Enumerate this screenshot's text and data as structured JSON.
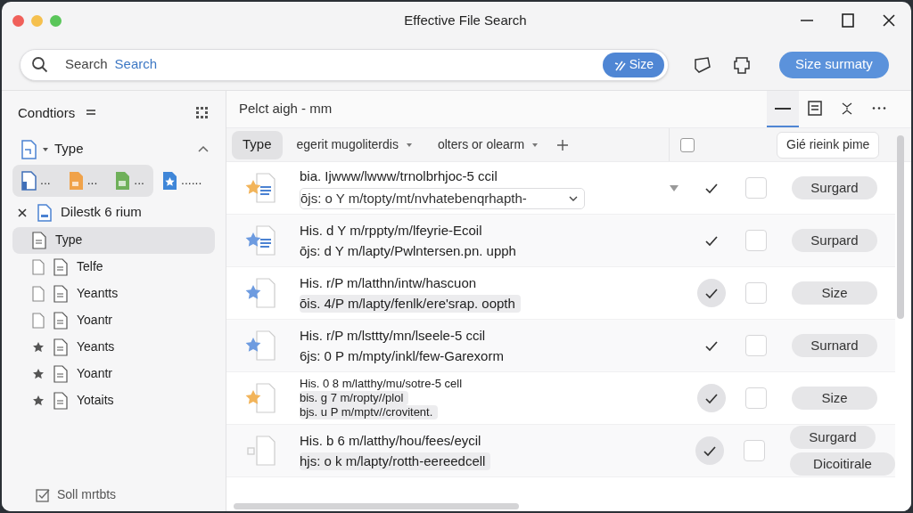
{
  "window": {
    "title": "Effective File Search"
  },
  "search": {
    "label": "Search",
    "value": "Search",
    "chip": "Size"
  },
  "toolbar": {
    "primary_button": "Size surmaty"
  },
  "sidebar": {
    "title": "Condtiors",
    "section": {
      "label": "Type",
      "expanded": true
    },
    "type_chips": [
      {
        "label": "...",
        "kind": "doc",
        "selected": true
      },
      {
        "label": "...",
        "kind": "orange",
        "selected": true
      },
      {
        "label": "...",
        "kind": "green",
        "selected": true
      },
      {
        "label": "......",
        "kind": "star",
        "selected": false
      }
    ],
    "filter": {
      "label": "Dilestk 6 rium"
    },
    "items": [
      {
        "label": "Type",
        "kind": "plain",
        "selected": true
      },
      {
        "label": "Telfe",
        "kind": "file",
        "selected": false
      },
      {
        "label": "Yeantts",
        "kind": "file",
        "selected": false
      },
      {
        "label": "Yoantr",
        "kind": "file",
        "selected": false
      },
      {
        "label": "Yeants",
        "kind": "star",
        "selected": false
      },
      {
        "label": "Yoantr",
        "kind": "star",
        "selected": false
      },
      {
        "label": "Yotaits",
        "kind": "star",
        "selected": false
      }
    ],
    "footer": "Soll mrtbts"
  },
  "main": {
    "heading": "Pelct aigh - mm",
    "views": [
      {
        "kind": "minus",
        "selected": true
      },
      {
        "kind": "list",
        "selected": false
      },
      {
        "kind": "collapse",
        "selected": false
      },
      {
        "kind": "more",
        "selected": false
      }
    ],
    "columns": [
      {
        "label": "Type",
        "selected": true,
        "dropdown": false
      },
      {
        "label": "egerit mugoliterdis",
        "selected": false,
        "dropdown": true
      },
      {
        "label": "olters or olearm",
        "selected": false,
        "dropdown": true
      }
    ],
    "header_checkbox": {
      "checked": false
    },
    "header_button": "Gié rieink pime",
    "rows": [
      {
        "color": "#f2b45a",
        "lines": [
          "bia. Ijwww/lwww/trnolbrhjoc-5 ccil",
          "ōjs: o Y m/topty/mt/nvhatebenqrhapth-"
        ],
        "kind": "dropdown",
        "sort_mark": true,
        "checked": true,
        "highlight": false,
        "selected": false,
        "pills": [
          "Surgard"
        ]
      },
      {
        "color": "#6d9be0",
        "lines": [
          "His. d Y m/rppty/m/lfeyrie-Ecoil",
          "ōjs: d Y m/lapty/Pwlntersen.pn. upph"
        ],
        "kind": "plain",
        "sort_mark": false,
        "checked": true,
        "highlight": false,
        "selected": false,
        "pills": [
          "Surpard"
        ]
      },
      {
        "color": "#6d9be0",
        "lines": [
          "His. r/P m/latthn/intw/hascuon",
          "ōis. 4/P m/lapty/fenlk/ere'srap. oopth"
        ],
        "kind": "chip",
        "sort_mark": false,
        "checked": true,
        "highlight": true,
        "selected": false,
        "pills": [
          "Size"
        ]
      },
      {
        "color": "#6d9be0",
        "lines": [
          "His. r/P m/lsttty/mn/lseele-5 ccil",
          "6js: 0 P m/mpty/inkl/few-Garexorm"
        ],
        "kind": "plain",
        "sort_mark": false,
        "checked": true,
        "highlight": false,
        "selected": false,
        "pills": [
          "Surnard"
        ]
      },
      {
        "color": "#f2b45a",
        "lines": [
          "His. 0 8 m/latthy/mu/sotre-5 cell",
          "bis. g 7 m/ropty//plol",
          "bjs. u P m/mptv//crovitent."
        ],
        "kind": "chip",
        "sort_mark": false,
        "checked": true,
        "highlight": true,
        "selected": false,
        "pills": [
          "Size"
        ]
      },
      {
        "lines": [
          "His. b 6 m/latthy/hou/fees/eycil",
          "hjs: o k m/lapty/rotth-eereedcell"
        ],
        "kind": "chip",
        "sort_mark": false,
        "checked": true,
        "highlight": true,
        "selected": false,
        "pills": [
          "Surgard",
          "Dicoitirale"
        ]
      }
    ]
  }
}
